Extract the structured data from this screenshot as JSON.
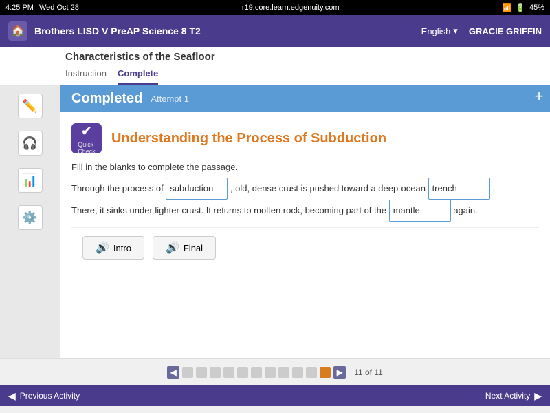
{
  "status_bar": {
    "time": "4:25 PM",
    "day": "Wed Oct 28",
    "url": "r19.core.learn.edgenuity.com",
    "battery": "45%",
    "wifi": "WiFi"
  },
  "top_nav": {
    "home_icon": "🏠",
    "course_title": "Brothers LISD V PreAP Science 8 T2",
    "language": "English",
    "user_name": "GRACIE GRIFFIN"
  },
  "sub_header": {
    "page_title": "Characteristics of the Seafloor",
    "tabs": [
      {
        "label": "Instruction",
        "active": false
      },
      {
        "label": "Complete",
        "active": true
      }
    ]
  },
  "completed_banner": {
    "label": "Completed",
    "attempt": "Attempt 1"
  },
  "add_button": "+",
  "sidebar_icons": [
    "✏️",
    "🎧",
    "📊",
    "⚙️"
  ],
  "quick_check": {
    "title": "Understanding the Process of Subduction",
    "qc_text": "Quick\nCheck",
    "instruction": "Fill in the blanks to complete the passage.",
    "sentences": [
      {
        "before": "Through the process of ",
        "input_value": "subduction",
        "after": ", old, dense crust is pushed toward a deep-ocean ",
        "input2_value": "trench",
        "end": "."
      },
      {
        "before": "There, it sinks under lighter crust. It returns to molten rock, becoming part of the ",
        "input_value": "mantle",
        "after": " again."
      }
    ]
  },
  "audio_buttons": [
    {
      "label": "Intro",
      "icon": "🔊"
    },
    {
      "label": "Final",
      "icon": "🔊"
    }
  ],
  "pagination": {
    "current": 11,
    "total": 11,
    "page_count_label": "11 of 11"
  },
  "bottom_nav": {
    "prev_label": "Previous Activity",
    "next_label": "Next Activity"
  }
}
